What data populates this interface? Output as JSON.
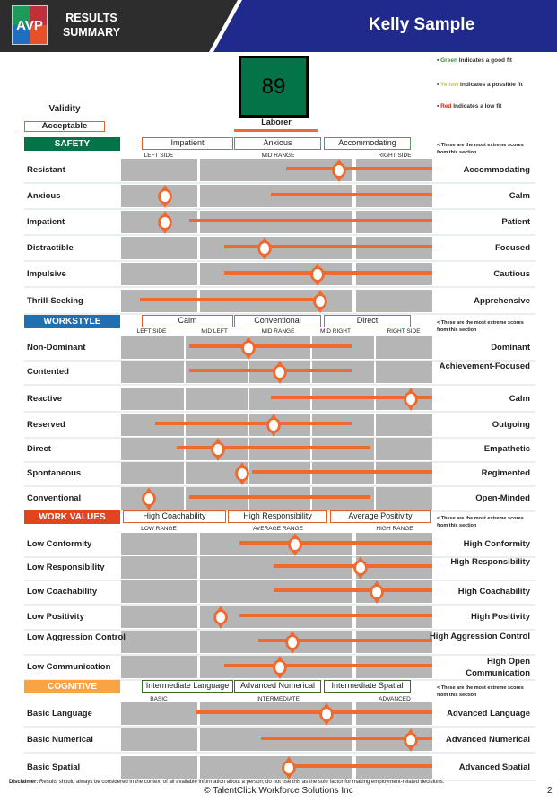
{
  "header": {
    "logo_text": "AVP",
    "title_line1": "RESULTS",
    "title_line2": "SUMMARY",
    "person_name": "Kelly Sample"
  },
  "score": {
    "value": "89",
    "job": "Laborer",
    "color": "#047347"
  },
  "legend": [
    {
      "word": "Green",
      "rest": " Indicates a good fit",
      "color": "#3a8a3a"
    },
    {
      "word": "Yellow",
      "rest": " Indicates a possible fit",
      "color": "#d8c21a"
    },
    {
      "word": "Red",
      "rest": " Indicates a low fit",
      "color": "#d0201a"
    }
  ],
  "validity": {
    "label": "Validity",
    "value": "Acceptable"
  },
  "note": "< These are the most extreme scores from this section",
  "sections": [
    {
      "title": "SAFETY",
      "color": "#047347",
      "top_traits": [
        "Impatient",
        "Anxious",
        "Accommodating"
      ],
      "trait_border": "#e0602a",
      "scale_labels": [
        "LEFT SIDE",
        "MID RANGE",
        "RIGHT SIDE"
      ],
      "rows": [
        {
          "left": "Resistant",
          "right": "Accommodating",
          "range": [
            0.53,
            1.0
          ],
          "score": 0.7
        },
        {
          "left": "Anxious",
          "right": "Calm",
          "range": [
            0.48,
            1.0
          ],
          "score": 0.14
        },
        {
          "left": "Impatient",
          "right": "Patient",
          "range": [
            0.22,
            1.0
          ],
          "score": 0.14
        },
        {
          "left": "Distractible",
          "right": "Focused",
          "range": [
            0.33,
            1.0
          ],
          "score": 0.46
        },
        {
          "left": "Impulsive",
          "right": "Cautious",
          "range": [
            0.33,
            1.0
          ],
          "score": 0.63
        },
        {
          "left": "Thrill-Seeking",
          "right": "Apprehensive",
          "range": [
            0.06,
            0.65
          ],
          "score": 0.64
        }
      ]
    },
    {
      "title": "WORKSTYLE",
      "color": "#1f6fb2",
      "top_traits": [
        "Calm",
        "Conventional",
        "Direct"
      ],
      "trait_border": "#e0602a",
      "scale_labels": [
        "LEFT SIDE",
        "MID LEFT",
        "MID RANGE",
        "MID RIGHT",
        "RIGHT SIDE"
      ],
      "rows": [
        {
          "left": "Non-Dominant",
          "right": "Dominant",
          "range": [
            0.22,
            0.74
          ],
          "score": 0.41
        },
        {
          "left": "Contented",
          "right": "Achievement-Focused",
          "range": [
            0.22,
            0.74
          ],
          "score": 0.51
        },
        {
          "left": "Reactive",
          "right": "Calm",
          "range": [
            0.48,
            1.0
          ],
          "score": 0.93
        },
        {
          "left": "Reserved",
          "right": "Outgoing",
          "range": [
            0.11,
            0.74
          ],
          "score": 0.49
        },
        {
          "left": "Direct",
          "right": "Empathetic",
          "range": [
            0.18,
            0.8
          ],
          "score": 0.31
        },
        {
          "left": "Spontaneous",
          "right": "Regimented",
          "range": [
            0.42,
            1.0
          ],
          "score": 0.39
        },
        {
          "left": "Conventional",
          "right": "Open-Minded",
          "range": [
            0.22,
            0.8
          ],
          "score": 0.09
        }
      ]
    },
    {
      "title": "WORK VALUES",
      "color": "#e0461e",
      "top_traits": [
        "High Coachability",
        "High Responsibility",
        "Average Positivity"
      ],
      "trait_border": "#e0602a",
      "scale_labels": [
        "LOW RANGE",
        "AVERAGE RANGE",
        "HIGH RANGE"
      ],
      "rows": [
        {
          "left": "Low Conformity",
          "right": "High Conformity",
          "range": [
            0.38,
            1.0
          ],
          "score": 0.56
        },
        {
          "left": "Low Responsibility",
          "right": "High Responsibility",
          "range": [
            0.49,
            1.0
          ],
          "score": 0.77
        },
        {
          "left": "Low Coachability",
          "right": "High Coachability",
          "range": [
            0.49,
            1.0
          ],
          "score": 0.82
        },
        {
          "left": "Low Positivity",
          "right": "High Positivity",
          "range": [
            0.38,
            1.0
          ],
          "score": 0.32
        },
        {
          "left": "Low Aggression Control",
          "right": "High Aggression Control",
          "range": [
            0.44,
            1.0
          ],
          "score": 0.55
        },
        {
          "left": "Low Communication",
          "right": "High Open Communication",
          "range": [
            0.33,
            1.0
          ],
          "score": 0.51
        }
      ]
    },
    {
      "title": "COGNITIVE",
      "color": "#f7a445",
      "top_traits": [
        "Intermediate Language",
        "Advanced Numerical",
        "Intermediate Spatial"
      ],
      "trait_border": "#3d6b2a",
      "scale_labels": [
        "BASIC",
        "INTERMEDIATE",
        "ADVANCED"
      ],
      "rows": [
        {
          "left": "Basic Language",
          "right": "Advanced Language",
          "range": [
            0.24,
            1.0
          ],
          "score": 0.66
        },
        {
          "left": "Basic Numerical",
          "right": "Advanced Numerical",
          "range": [
            0.45,
            1.0
          ],
          "score": 0.93
        },
        {
          "left": "Basic Spatial",
          "right": "Advanced Spatial",
          "range": [
            0.54,
            1.0
          ],
          "score": 0.54
        }
      ]
    }
  ],
  "footer": {
    "disclaimer_label": "Disclaimer:",
    "disclaimer": " Results should always be considered in the context of all available information about a person; do not use this as the sole factor for making employment-related decisions.",
    "copyright": "© TalentClick Workforce Solutions Inc",
    "page": "2"
  }
}
